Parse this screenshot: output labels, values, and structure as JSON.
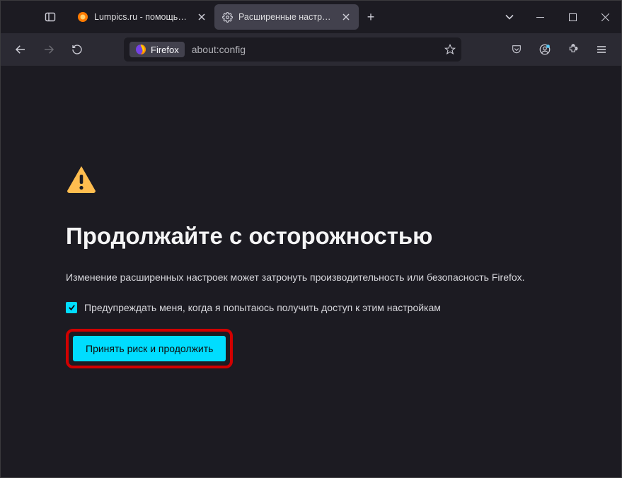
{
  "titlebar": {
    "tab1_label": "Lumpics.ru - помощь с компью",
    "tab2_label": "Расширенные настройки"
  },
  "urlbar": {
    "identity_label": "Firefox",
    "address": "about:config"
  },
  "warning": {
    "heading": "Продолжайте с осторожностью",
    "body": "Изменение расширенных настроек может затронуть производительность или безопасность Firefox.",
    "checkbox_label": "Предупреждать меня, когда я попытаюсь получить доступ к этим настройкам",
    "accept_label": "Принять риск и продолжить"
  }
}
